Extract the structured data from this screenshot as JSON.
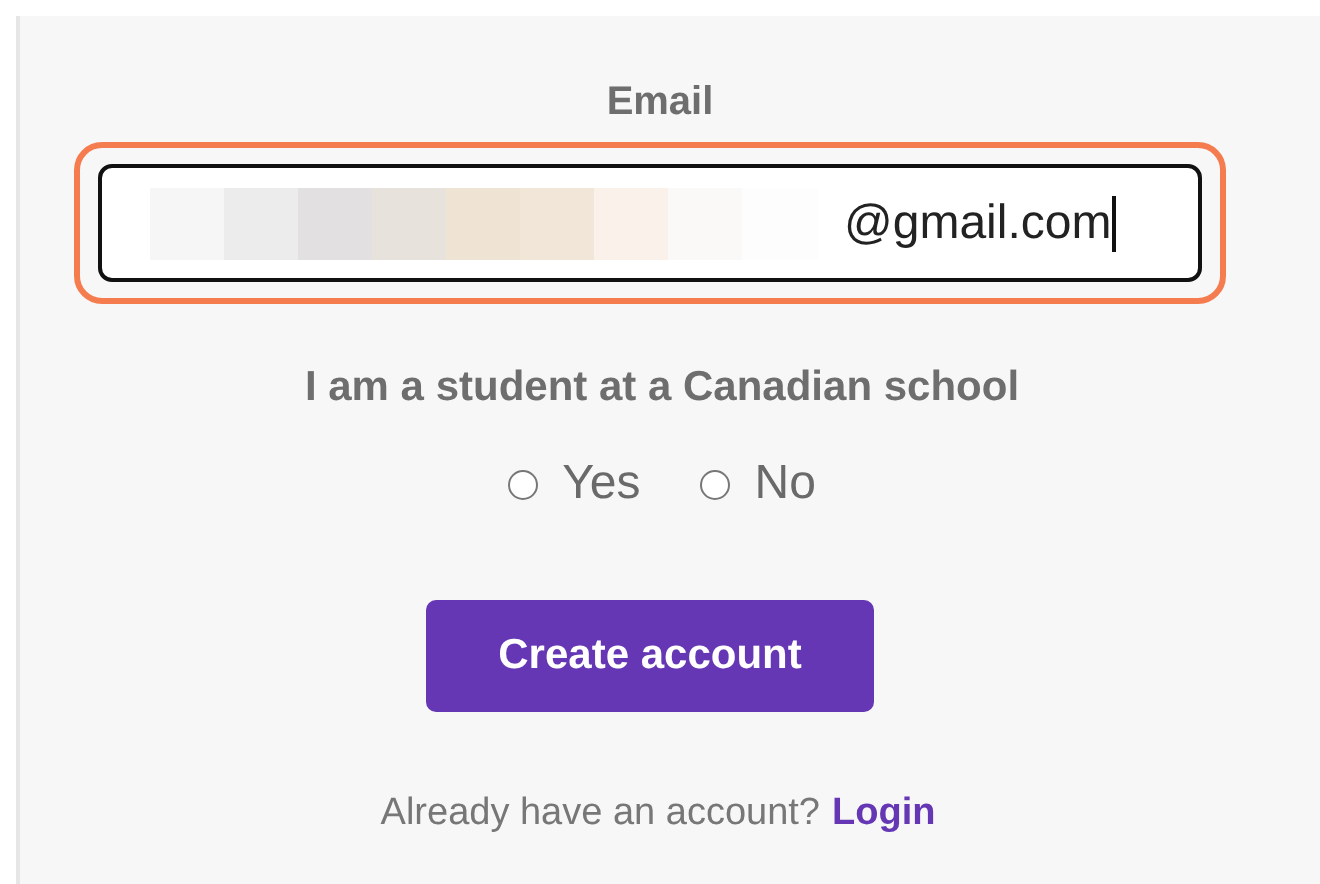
{
  "email": {
    "label": "Email",
    "value": "@gmail.com",
    "focused": true
  },
  "student_question": {
    "label": "I am a student at a Canadian school",
    "options": [
      {
        "label": "Yes",
        "selected": false
      },
      {
        "label": "No",
        "selected": false
      }
    ]
  },
  "buttons": [
    "Create account"
  ],
  "login_prompt": {
    "text": "Already have an account?",
    "link": "Login"
  }
}
